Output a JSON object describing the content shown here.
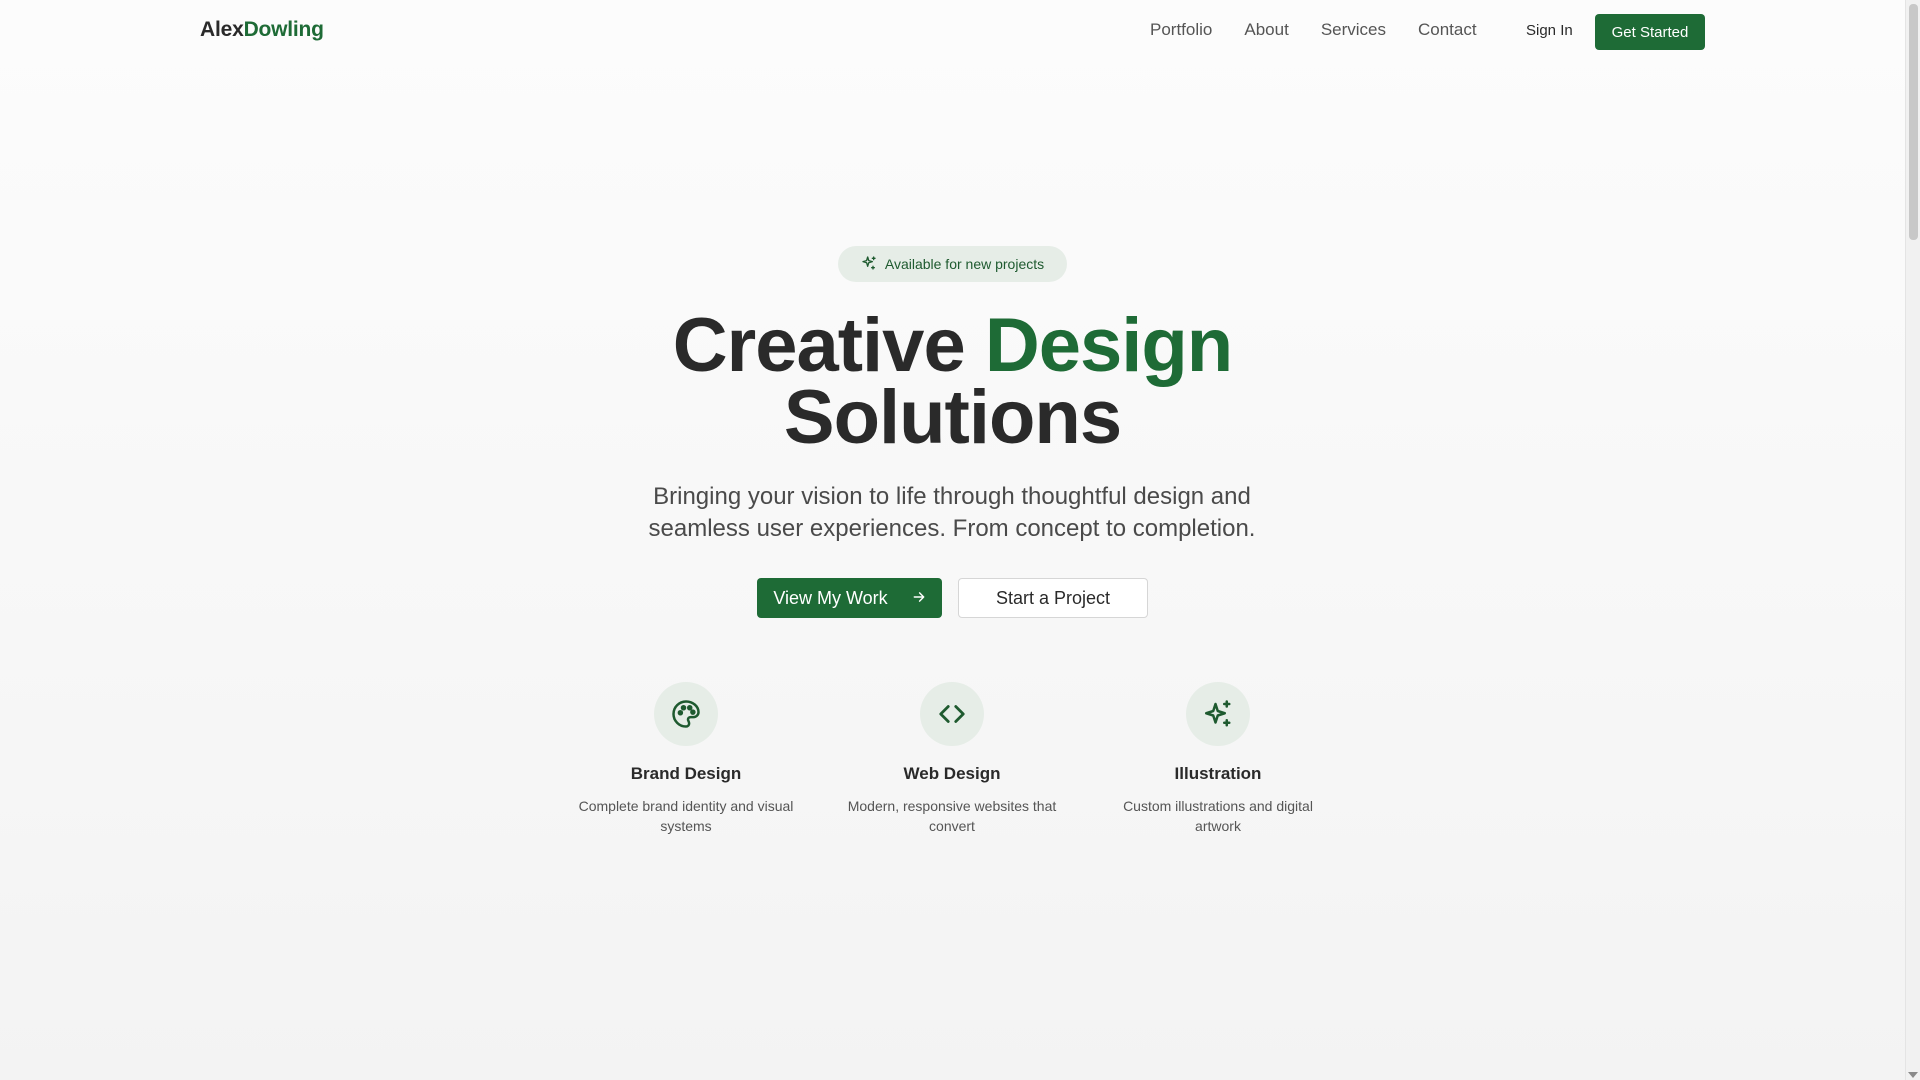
{
  "header": {
    "logo_first": "Alex",
    "logo_second": "Dowling",
    "nav": [
      "Portfolio",
      "About",
      "Services",
      "Contact"
    ],
    "sign_in": "Sign In",
    "get_started": "Get Started"
  },
  "hero": {
    "badge": "Available for new projects",
    "badge_icon": "sparkles-icon",
    "headline_part1": "Creative",
    "headline_accent": "Design",
    "headline_part2": "Solutions",
    "subtitle_line1": "Bringing your vision to life through thoughtful design and",
    "subtitle_line2": "seamless user experiences. From concept to completion.",
    "primary_button": "View My Work",
    "primary_button_icon": "arrow-right-icon",
    "secondary_button": "Start a Project"
  },
  "features": [
    {
      "icon": "palette-icon",
      "title": "Brand Design",
      "desc_line1": "Complete brand identity and visual",
      "desc_line2": "systems"
    },
    {
      "icon": "code-icon",
      "title": "Web Design",
      "desc_line1": "Modern, responsive websites that",
      "desc_line2": "convert"
    },
    {
      "icon": "sparkles-icon",
      "title": "Illustration",
      "desc_line1": "Custom illustrations and digital",
      "desc_line2": "artwork"
    }
  ],
  "colors": {
    "accent": "#1e6b36",
    "icon_bg": "#e6ede7",
    "text": "#2a2a2a"
  }
}
